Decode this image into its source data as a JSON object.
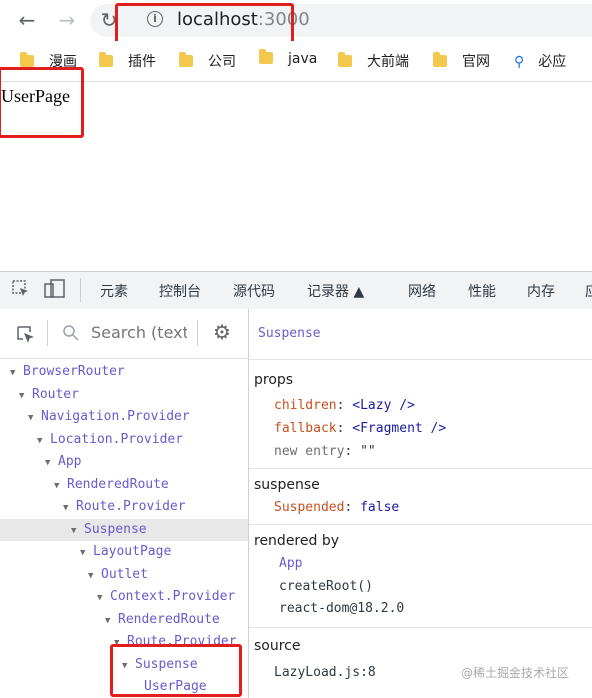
{
  "browser": {
    "back_icon": "arrow-left",
    "forward_icon": "arrow-right",
    "reload_icon": "reload",
    "url_host": "localhost",
    "url_port": ":3000"
  },
  "bookmarks": [
    {
      "label": "漫画",
      "icon": "folder"
    },
    {
      "label": "插件",
      "icon": "folder"
    },
    {
      "label": "公司",
      "icon": "folder"
    },
    {
      "label": "java",
      "icon": "folder"
    },
    {
      "label": "大前端",
      "icon": "folder"
    },
    {
      "label": "官网",
      "icon": "folder"
    },
    {
      "label": "必应",
      "icon": "search"
    }
  ],
  "page": {
    "text": "UserPage"
  },
  "devtools": {
    "tabs": [
      "元素",
      "控制台",
      "源代码",
      "记录器 ▲",
      "网络",
      "性能",
      "内存",
      "应"
    ],
    "search_placeholder": "Search (text",
    "tree": [
      {
        "label": "BrowserRouter"
      },
      {
        "label": "Router"
      },
      {
        "label": "Navigation.Provider"
      },
      {
        "label": "Location.Provider"
      },
      {
        "label": "App"
      },
      {
        "label": "RenderedRoute"
      },
      {
        "label": "Route.Provider"
      },
      {
        "label": "Suspense"
      },
      {
        "label": "LayoutPage"
      },
      {
        "label": "Outlet"
      },
      {
        "label": "Context.Provider"
      },
      {
        "label": "RenderedRoute"
      },
      {
        "label": "Route.Provider"
      },
      {
        "label": "Suspense"
      },
      {
        "label": "UserPage"
      }
    ],
    "selected_component": "Suspense",
    "props": {
      "heading": "props",
      "rows": [
        {
          "key": "children",
          "value": "<Lazy />"
        },
        {
          "key": "fallback",
          "value": "<Fragment />"
        },
        {
          "key": "new entry",
          "value": "\"\""
        }
      ]
    },
    "suspense": {
      "heading": "suspense",
      "key": "Suspended",
      "value": "false"
    },
    "rendered_by": {
      "heading": "rendered by",
      "items": [
        "App",
        "createRoot()",
        "react-dom@18.2.0"
      ]
    },
    "source": {
      "heading": "source",
      "file": "LazyLoad.js:8"
    }
  },
  "watermark": "@稀土掘金技术社区",
  "colors": {
    "highlight_box": "#e01e1e",
    "component_name": "#6a5acd",
    "prop_key": "#c8501e"
  }
}
